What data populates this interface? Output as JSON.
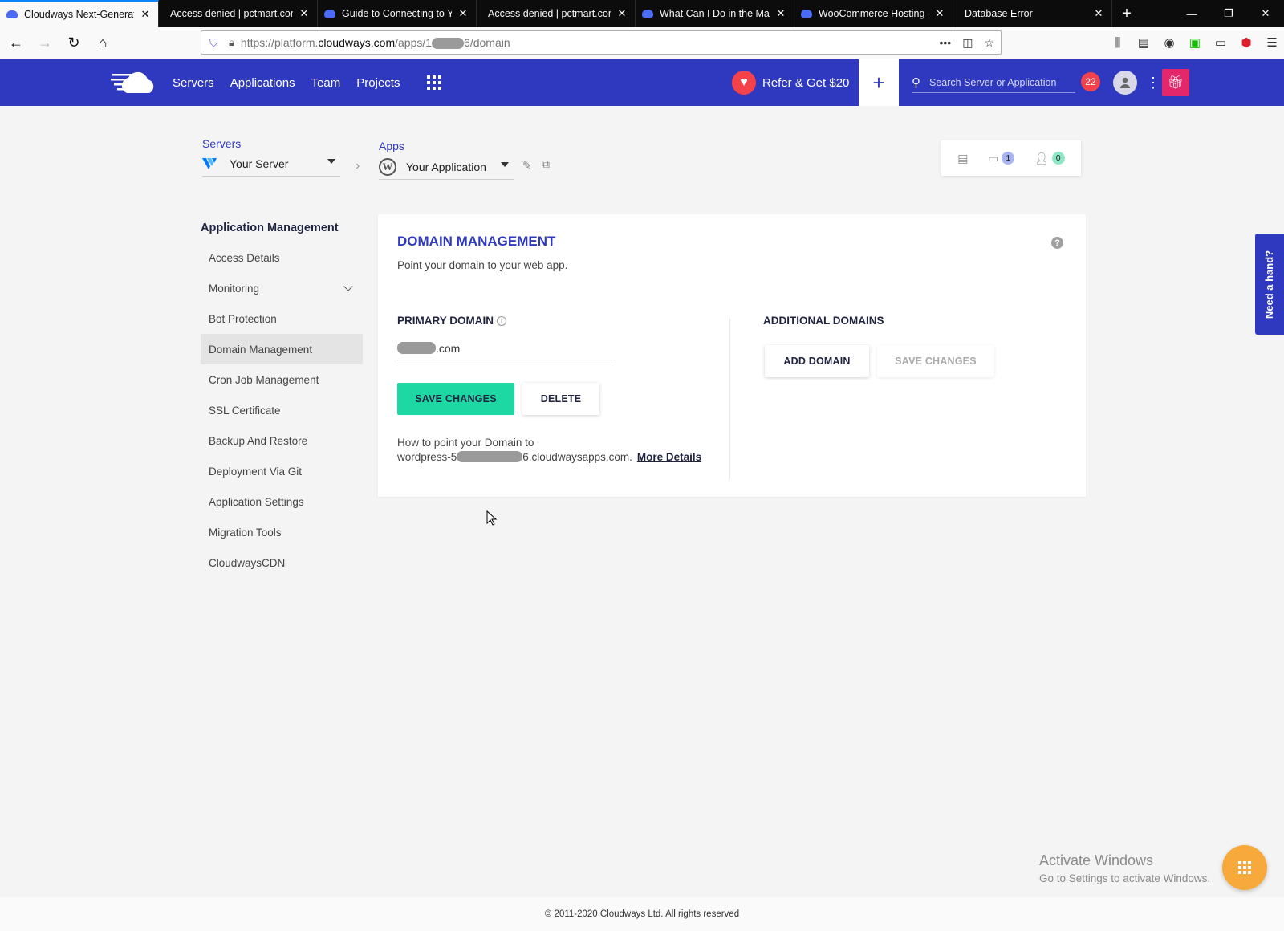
{
  "browser": {
    "tabs": [
      {
        "label": "Cloudways Next-Generatio",
        "active": true,
        "icon": "cloudways-favicon"
      },
      {
        "label": "Access denied | pctmart.com",
        "active": false,
        "icon": "none"
      },
      {
        "label": "Guide to Connecting to Yo",
        "active": false,
        "icon": "cloudways-favicon"
      },
      {
        "label": "Access denied | pctmart.com",
        "active": false,
        "icon": "none"
      },
      {
        "label": "What Can I Do in the Man",
        "active": false,
        "icon": "cloudways-favicon"
      },
      {
        "label": "WooCommerce Hosting -",
        "active": false,
        "icon": "cloudways-favicon"
      },
      {
        "label": "Database Error",
        "active": false,
        "icon": "none"
      }
    ],
    "url_prefix": "https://platform.",
    "url_domain": "cloudways.com",
    "url_mid": "/apps/1",
    "url_suffix": "6/domain"
  },
  "header": {
    "nav": [
      "Servers",
      "Applications",
      "Team",
      "Projects"
    ],
    "refer_label": "Refer & Get $20",
    "search_placeholder": "Search Server or Application",
    "notification_count": "22",
    "brand_color": "#2f39bf"
  },
  "breadcrumb": {
    "servers_label": "Servers",
    "server_name": "Your Server",
    "apps_label": "Apps",
    "app_name": "Your Application"
  },
  "stats": {
    "folders_count": "1",
    "users_count": "0"
  },
  "sidebar": {
    "title": "Application Management",
    "items": [
      {
        "label": "Access Details"
      },
      {
        "label": "Monitoring"
      },
      {
        "label": "Bot Protection"
      },
      {
        "label": "Domain Management"
      },
      {
        "label": "Cron Job Management"
      },
      {
        "label": "SSL Certificate"
      },
      {
        "label": "Backup And Restore"
      },
      {
        "label": "Deployment Via Git"
      },
      {
        "label": "Application Settings"
      },
      {
        "label": "Migration Tools"
      },
      {
        "label": "CloudwaysCDN"
      }
    ],
    "active_item": "Domain Management"
  },
  "domain": {
    "title": "DOMAIN MANAGEMENT",
    "subtitle": "Point your domain to your web app.",
    "primary_label": "PRIMARY DOMAIN",
    "primary_value_suffix": ".com",
    "save_label": "SAVE CHANGES",
    "delete_label": "DELETE",
    "howto_prefix": "How to point your Domain to",
    "howto_host_start": "wordpress-5",
    "howto_host_end": "6.cloudwaysapps.com.",
    "more_details": "More Details",
    "additional_label": "ADDITIONAL DOMAINS",
    "add_domain_label": "ADD DOMAIN",
    "additional_save_label": "SAVE CHANGES",
    "accent_color": "#1ed8a4"
  },
  "need_hand": "Need a hand?",
  "footer": "© 2011-2020 Cloudways Ltd. All rights reserved",
  "watermark": {
    "line1": "Activate Windows",
    "line2": "Go to Settings to activate Windows."
  }
}
